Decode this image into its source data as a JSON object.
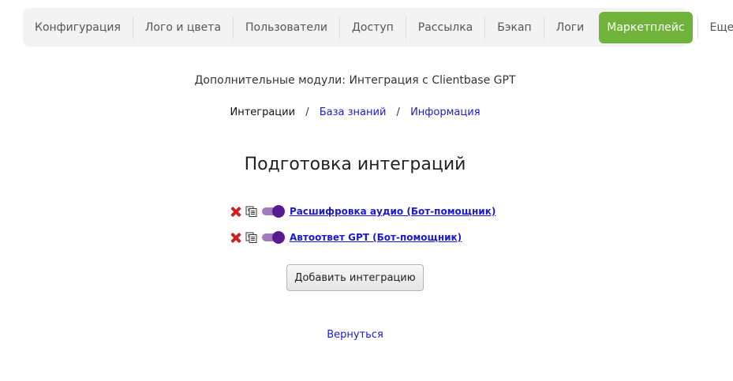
{
  "nav": {
    "items": [
      {
        "label": "Конфигурация"
      },
      {
        "label": "Лого и цвета"
      },
      {
        "label": "Пользователи"
      },
      {
        "label": "Доступ"
      },
      {
        "label": "Рассылка"
      },
      {
        "label": "Бэкап"
      },
      {
        "label": "Логи"
      },
      {
        "label": "Маркетплейс",
        "active": true
      },
      {
        "label": "Еще"
      }
    ],
    "active_color": "#6fb33a"
  },
  "module_title": "Дополнительные модули: Интеграция с Clientbase GPT",
  "breadcrumb": {
    "current": "Интеграции",
    "separator": "/",
    "links": [
      "База знаний",
      "Информация"
    ]
  },
  "section_heading": "Подготовка интеграций",
  "integrations": [
    {
      "label": "Расшифровка аудио (Бот-помощник)",
      "enabled": true,
      "icons": [
        "delete-icon",
        "copy-icon",
        "toggle"
      ]
    },
    {
      "label": "Автоответ GPT (Бот-помощник)",
      "enabled": true,
      "icons": [
        "delete-icon",
        "copy-icon",
        "toggle"
      ]
    }
  ],
  "add_button_label": "Добавить интеграцию",
  "back_link": "Вернуться",
  "colors": {
    "link": "#1a1acc",
    "delete": "#cc2222",
    "toggle_knob": "#5a1a8f",
    "toggle_track": "#a27bbf"
  }
}
